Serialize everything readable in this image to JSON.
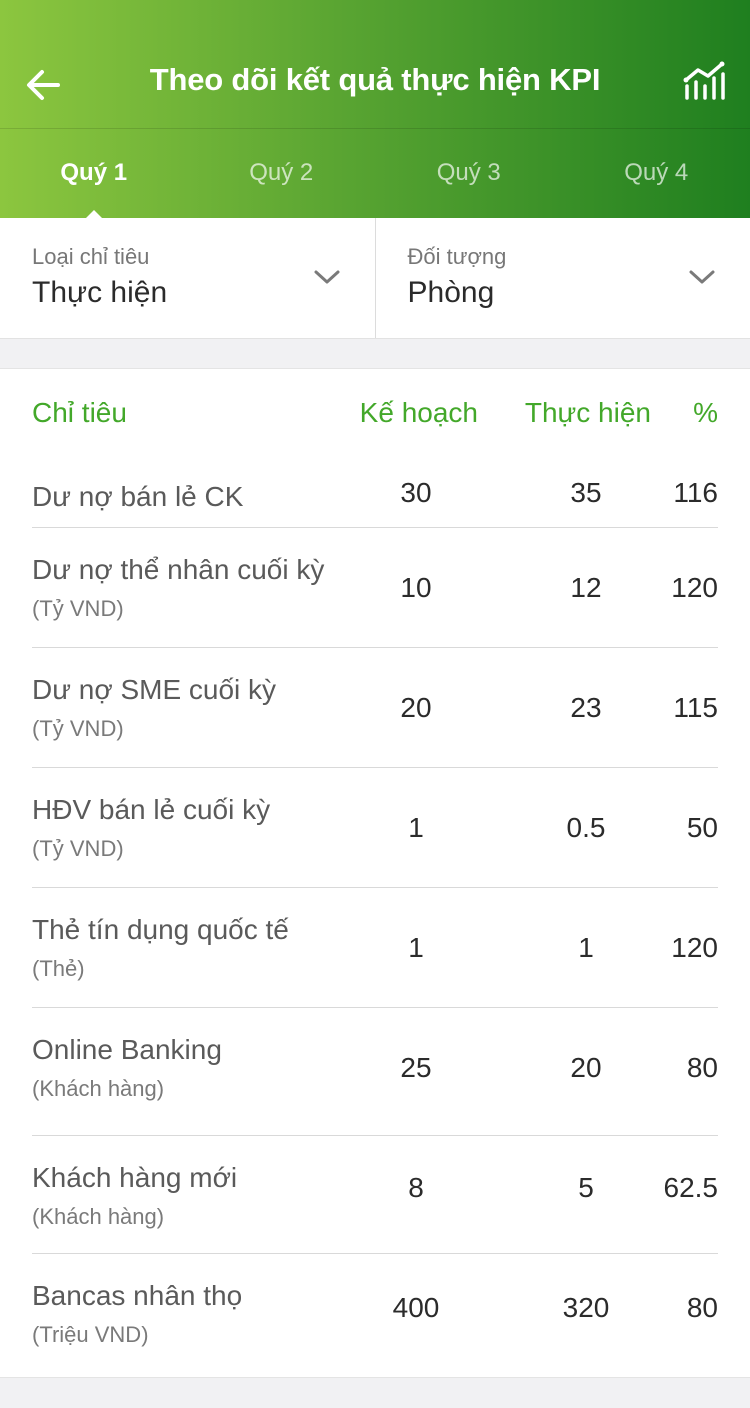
{
  "header": {
    "title": "Theo dõi kết quả thực hiện KPI",
    "back_icon": "back-arrow-icon",
    "chart_icon": "chart-icon"
  },
  "tabs": [
    {
      "label": "Quý 1",
      "active": true
    },
    {
      "label": "Quý 2",
      "active": false
    },
    {
      "label": "Quý 3",
      "active": false
    },
    {
      "label": "Quý 4",
      "active": false
    }
  ],
  "filters": {
    "indicator_type": {
      "label": "Loại chỉ tiêu",
      "value": "Thực hiện"
    },
    "subject": {
      "label": "Đối tượng",
      "value": "Phòng"
    }
  },
  "table": {
    "columns": {
      "name": "Chỉ tiêu",
      "plan": "Kế hoạch",
      "actual": "Thực hiện",
      "percent": "%"
    },
    "rows": [
      {
        "name": "Dư nợ bán lẻ CK",
        "unit": "",
        "plan": "30",
        "actual": "35",
        "percent": "116"
      },
      {
        "name": "Dư nợ thể nhân cuối kỳ",
        "unit": "(Tỷ VND)",
        "plan": "10",
        "actual": "12",
        "percent": "120"
      },
      {
        "name": "Dư nợ SME cuối kỳ",
        "unit": "(Tỷ VND)",
        "plan": "20",
        "actual": "23",
        "percent": "115"
      },
      {
        "name": "HĐV bán lẻ cuối kỳ",
        "unit": "(Tỷ VND)",
        "plan": "1",
        "actual": "0.5",
        "percent": "50"
      },
      {
        "name": "Thẻ tín dụng quốc tế",
        "unit": "(Thẻ)",
        "plan": "1",
        "actual": "1",
        "percent": "120"
      },
      {
        "name": "Online Banking",
        "unit": "(Khách hàng)",
        "plan": "25",
        "actual": "20",
        "percent": "80"
      },
      {
        "name": "Khách hàng mới",
        "unit": "(Khách hàng)",
        "plan": "8",
        "actual": "5",
        "percent": "62.5"
      },
      {
        "name": "Bancas nhân thọ",
        "unit": "(Triệu VND)",
        "plan": "400",
        "actual": "320",
        "percent": "80"
      }
    ]
  },
  "colors": {
    "accent_green": "#43a82a",
    "header_gradient_start": "#8cc63f",
    "header_gradient_end": "#1f7f1f"
  }
}
